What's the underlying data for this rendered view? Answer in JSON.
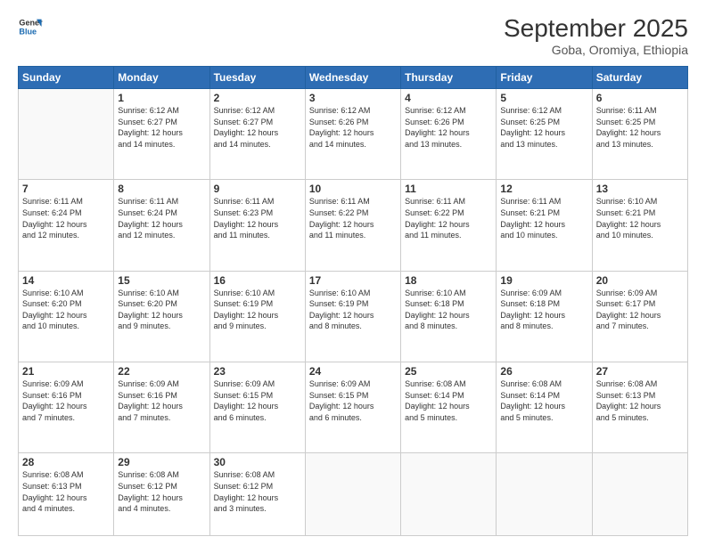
{
  "header": {
    "logo_line1": "General",
    "logo_line2": "Blue",
    "month": "September 2025",
    "location": "Goba, Oromiya, Ethiopia"
  },
  "weekdays": [
    "Sunday",
    "Monday",
    "Tuesday",
    "Wednesday",
    "Thursday",
    "Friday",
    "Saturday"
  ],
  "weeks": [
    [
      {
        "day": "",
        "empty": true
      },
      {
        "day": "1",
        "sunrise": "6:12 AM",
        "sunset": "6:27 PM",
        "daylight": "12 hours and 14 minutes."
      },
      {
        "day": "2",
        "sunrise": "6:12 AM",
        "sunset": "6:27 PM",
        "daylight": "12 hours and 14 minutes."
      },
      {
        "day": "3",
        "sunrise": "6:12 AM",
        "sunset": "6:26 PM",
        "daylight": "12 hours and 14 minutes."
      },
      {
        "day": "4",
        "sunrise": "6:12 AM",
        "sunset": "6:26 PM",
        "daylight": "12 hours and 13 minutes."
      },
      {
        "day": "5",
        "sunrise": "6:12 AM",
        "sunset": "6:25 PM",
        "daylight": "12 hours and 13 minutes."
      },
      {
        "day": "6",
        "sunrise": "6:11 AM",
        "sunset": "6:25 PM",
        "daylight": "12 hours and 13 minutes."
      }
    ],
    [
      {
        "day": "7",
        "sunrise": "6:11 AM",
        "sunset": "6:24 PM",
        "daylight": "12 hours and 12 minutes."
      },
      {
        "day": "8",
        "sunrise": "6:11 AM",
        "sunset": "6:24 PM",
        "daylight": "12 hours and 12 minutes."
      },
      {
        "day": "9",
        "sunrise": "6:11 AM",
        "sunset": "6:23 PM",
        "daylight": "12 hours and 11 minutes."
      },
      {
        "day": "10",
        "sunrise": "6:11 AM",
        "sunset": "6:22 PM",
        "daylight": "12 hours and 11 minutes."
      },
      {
        "day": "11",
        "sunrise": "6:11 AM",
        "sunset": "6:22 PM",
        "daylight": "12 hours and 11 minutes."
      },
      {
        "day": "12",
        "sunrise": "6:11 AM",
        "sunset": "6:21 PM",
        "daylight": "12 hours and 10 minutes."
      },
      {
        "day": "13",
        "sunrise": "6:10 AM",
        "sunset": "6:21 PM",
        "daylight": "12 hours and 10 minutes."
      }
    ],
    [
      {
        "day": "14",
        "sunrise": "6:10 AM",
        "sunset": "6:20 PM",
        "daylight": "12 hours and 10 minutes."
      },
      {
        "day": "15",
        "sunrise": "6:10 AM",
        "sunset": "6:20 PM",
        "daylight": "12 hours and 9 minutes."
      },
      {
        "day": "16",
        "sunrise": "6:10 AM",
        "sunset": "6:19 PM",
        "daylight": "12 hours and 9 minutes."
      },
      {
        "day": "17",
        "sunrise": "6:10 AM",
        "sunset": "6:19 PM",
        "daylight": "12 hours and 8 minutes."
      },
      {
        "day": "18",
        "sunrise": "6:10 AM",
        "sunset": "6:18 PM",
        "daylight": "12 hours and 8 minutes."
      },
      {
        "day": "19",
        "sunrise": "6:09 AM",
        "sunset": "6:18 PM",
        "daylight": "12 hours and 8 minutes."
      },
      {
        "day": "20",
        "sunrise": "6:09 AM",
        "sunset": "6:17 PM",
        "daylight": "12 hours and 7 minutes."
      }
    ],
    [
      {
        "day": "21",
        "sunrise": "6:09 AM",
        "sunset": "6:16 PM",
        "daylight": "12 hours and 7 minutes."
      },
      {
        "day": "22",
        "sunrise": "6:09 AM",
        "sunset": "6:16 PM",
        "daylight": "12 hours and 7 minutes."
      },
      {
        "day": "23",
        "sunrise": "6:09 AM",
        "sunset": "6:15 PM",
        "daylight": "12 hours and 6 minutes."
      },
      {
        "day": "24",
        "sunrise": "6:09 AM",
        "sunset": "6:15 PM",
        "daylight": "12 hours and 6 minutes."
      },
      {
        "day": "25",
        "sunrise": "6:08 AM",
        "sunset": "6:14 PM",
        "daylight": "12 hours and 5 minutes."
      },
      {
        "day": "26",
        "sunrise": "6:08 AM",
        "sunset": "6:14 PM",
        "daylight": "12 hours and 5 minutes."
      },
      {
        "day": "27",
        "sunrise": "6:08 AM",
        "sunset": "6:13 PM",
        "daylight": "12 hours and 5 minutes."
      }
    ],
    [
      {
        "day": "28",
        "sunrise": "6:08 AM",
        "sunset": "6:13 PM",
        "daylight": "12 hours and 4 minutes."
      },
      {
        "day": "29",
        "sunrise": "6:08 AM",
        "sunset": "6:12 PM",
        "daylight": "12 hours and 4 minutes."
      },
      {
        "day": "30",
        "sunrise": "6:08 AM",
        "sunset": "6:12 PM",
        "daylight": "12 hours and 3 minutes."
      },
      {
        "day": "",
        "empty": true
      },
      {
        "day": "",
        "empty": true
      },
      {
        "day": "",
        "empty": true
      },
      {
        "day": "",
        "empty": true
      }
    ]
  ]
}
